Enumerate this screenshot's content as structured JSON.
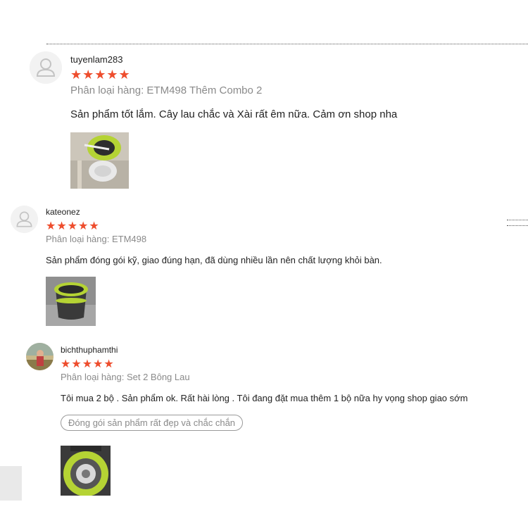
{
  "reviews": [
    {
      "username": "tuyenlam283",
      "stars": "★★★★★",
      "variant": "Phân loại hàng: ETM498 Thêm Combo 2",
      "comment": "Sản phẩm tốt lắm. Cây lau chắc và  Xài rất êm nữa. Cảm ơn shop nha",
      "avatar_icon": "default-user-icon",
      "photo": "mop-bucket-photo"
    },
    {
      "username": "kateonez",
      "stars": "★★★★★",
      "variant": "Phân loại hàng: ETM498",
      "comment": "Sản phẩm đóng gói kỹ, giao đúng hạn, đã dùng nhiều lần nên chất lượng khỏi bàn.",
      "avatar_icon": "default-user-icon",
      "photo": "mop-bucket-photo"
    },
    {
      "username": "bichthuphamthi",
      "stars": "★★★★★",
      "variant": "Phân loại hàng: Set 2 Bông Lau",
      "comment": "Tôi mua 2 bộ . Sản phẩm ok. Rất hài lòng . Tôi đang đặt mua thêm 1 bộ nữa hy vọng shop giao sớm",
      "tag": "Đóng gói sản phẩm rất đẹp và chắc chắn",
      "avatar_icon": "profile-photo",
      "photo": "mop-bucket-photo"
    }
  ],
  "colors": {
    "star": "#ee4d2d",
    "variant_text": "#8a8a8a",
    "bucket_green": "#b5d334"
  }
}
